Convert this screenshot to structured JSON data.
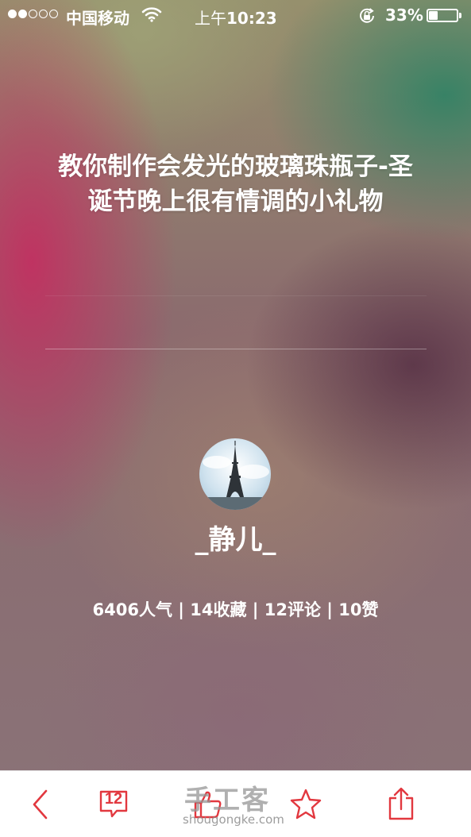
{
  "status_bar": {
    "signal_bars_on": 2,
    "signal_bars_total": 5,
    "carrier": "中国移动",
    "time_prefix": "上午",
    "time": "10:23",
    "battery_percent": "33%",
    "battery_level": 0.33
  },
  "article": {
    "title": "教你制作会发光的玻璃珠瓶子-圣诞节晚上很有情调的小礼物",
    "author": "_静儿_",
    "stats": "6406人气 | 14收藏 | 12评论 | 10赞"
  },
  "toolbar": {
    "back_icon": "chevron-left-icon",
    "comment_icon": "comment-bubble-icon",
    "comment_count": "12",
    "like_icon": "thumbs-up-icon",
    "favorite_icon": "star-icon",
    "share_icon": "share-icon",
    "accent_color": "#e2383f"
  },
  "watermark": {
    "title": "手工客",
    "url": "shougongke.com"
  }
}
